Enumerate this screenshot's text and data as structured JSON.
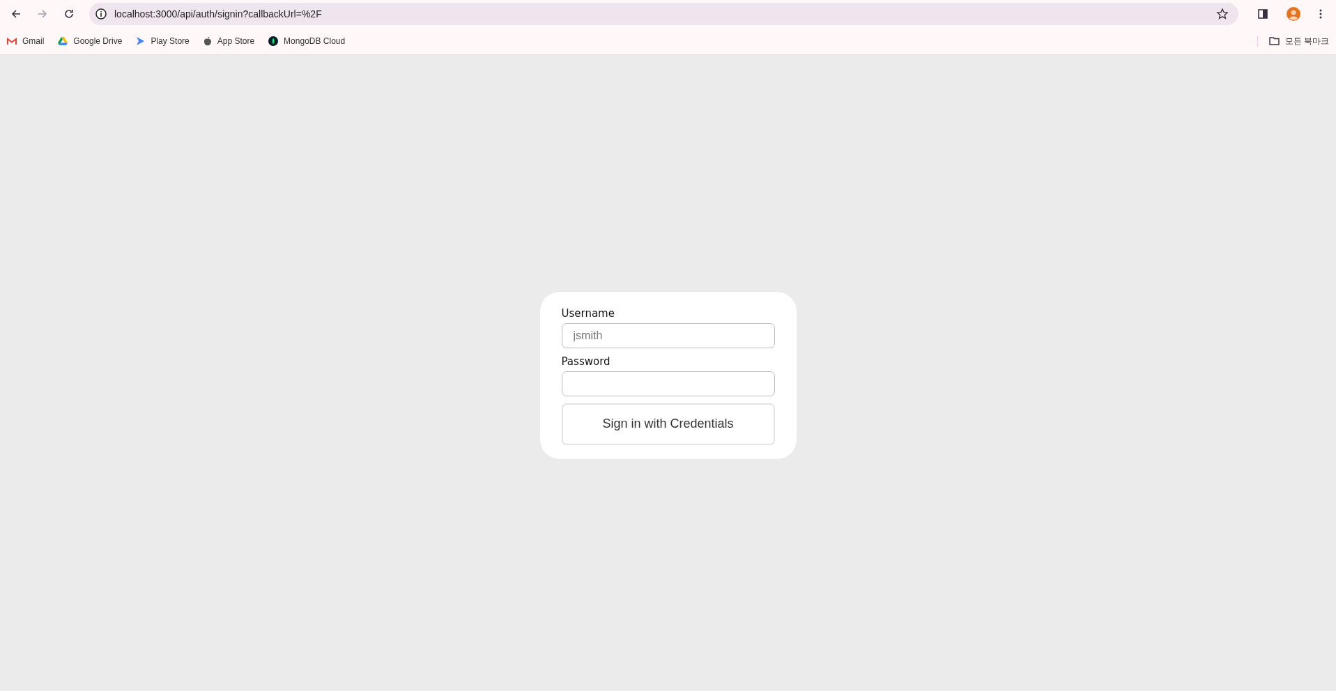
{
  "browser": {
    "url": "localhost:3000/api/auth/signin?callbackUrl=%2F",
    "bookmarks": [
      {
        "label": "Gmail"
      },
      {
        "label": "Google Drive"
      },
      {
        "label": "Play Store"
      },
      {
        "label": "App Store"
      },
      {
        "label": "MongoDB Cloud"
      }
    ],
    "all_bookmarks": "모든 북마크"
  },
  "form": {
    "fields": [
      {
        "label": "Username",
        "placeholder": "jsmith"
      },
      {
        "label": "Password"
      }
    ],
    "button": "Sign in with Credentials"
  }
}
